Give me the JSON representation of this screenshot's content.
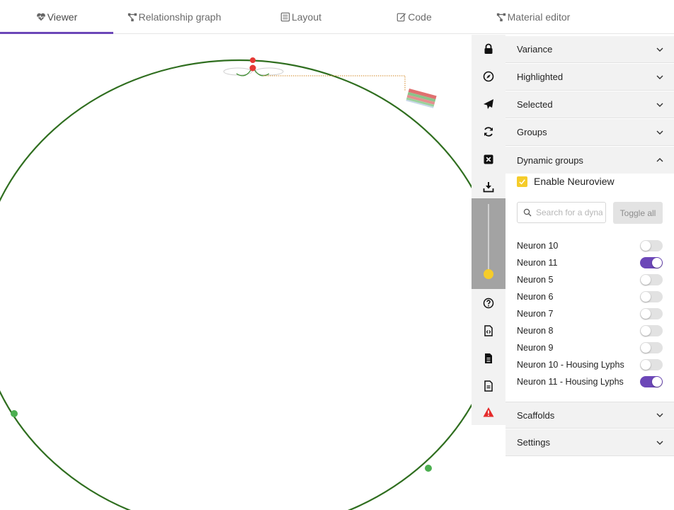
{
  "tabs": [
    {
      "label": "Viewer",
      "icon": "heart-pulse-icon"
    },
    {
      "label": "Relationship graph",
      "icon": "graph-icon"
    },
    {
      "label": "Layout",
      "icon": "layout-icon"
    },
    {
      "label": "Code",
      "icon": "edit-icon"
    },
    {
      "label": "Material editor",
      "icon": "graph-icon"
    }
  ],
  "active_tab": "Viewer",
  "toolbar": [
    "lock-icon",
    "compass-icon",
    "send-icon",
    "refresh-icon",
    "close-box-icon",
    "download-icon",
    "help-icon",
    "code-file-icon",
    "file-text-icon",
    "file-lines-icon",
    "warning-icon"
  ],
  "slider": {
    "value": 0.92
  },
  "panel": {
    "sections_top": [
      "Variance",
      "Highlighted",
      "Selected",
      "Groups"
    ],
    "dynamic_groups": {
      "title": "Dynamic groups",
      "enable_label": "Enable Neuroview",
      "enabled": true,
      "search_placeholder": "Search for a dynamic group",
      "toggle_all_label": "Toggle all",
      "items": [
        {
          "label": "Neuron 10",
          "on": false
        },
        {
          "label": "Neuron 11",
          "on": true
        },
        {
          "label": "Neuron 5",
          "on": false
        },
        {
          "label": "Neuron 6",
          "on": false
        },
        {
          "label": "Neuron 7",
          "on": false
        },
        {
          "label": "Neuron 8",
          "on": false
        },
        {
          "label": "Neuron 9",
          "on": false
        },
        {
          "label": "Neuron 10 - Housing Lyphs",
          "on": false
        },
        {
          "label": "Neuron 11 - Housing Lyphs",
          "on": true
        }
      ]
    },
    "sections_bottom": [
      "Scaffolds",
      "Settings"
    ]
  },
  "colors": {
    "accent": "#6c47b8",
    "checkbox": "#f5cc2a",
    "ring": "#2f6e1f",
    "node_red": "#e53935",
    "node_green": "#4caf50"
  }
}
